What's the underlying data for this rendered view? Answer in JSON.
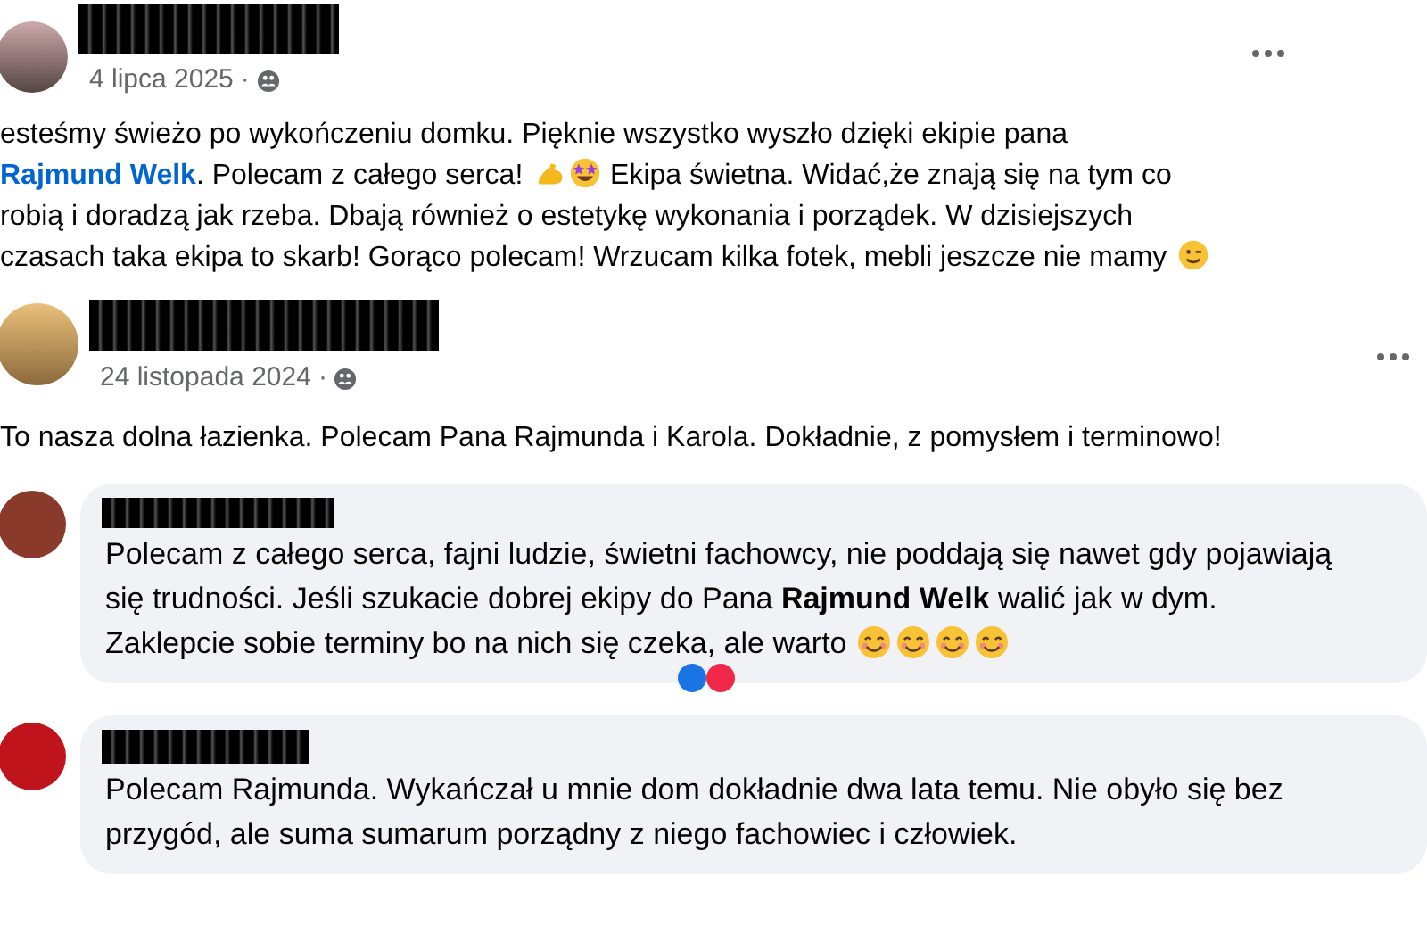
{
  "posts": [
    {
      "date": "4 lipca 2025",
      "separator": "·",
      "segments": [
        {
          "kind": "text",
          "text": "esteśmy świeżo po wykończeniu domku. Pięknie wszystko wyszło dzięki ekipie pana "
        },
        {
          "kind": "link",
          "text": "Rajmund Welk"
        },
        {
          "kind": "text",
          "text": ". Polecam z całego serca! "
        },
        {
          "kind": "arm"
        },
        {
          "kind": "starstruck"
        },
        {
          "kind": "text",
          "text": " Ekipa świetna. Widać,że znają się na tym co robią i doradzą jak rzeba. Dbają również o estetykę wykonania i porządek. W dzisiejszych czasach taka ekipa to skarb! Gorąco polecam! Wrzucam kilka fotek, mebli jeszcze nie mamy "
        },
        {
          "kind": "wink"
        }
      ]
    },
    {
      "date": "24 listopada 2024",
      "separator": "·",
      "segments": [
        {
          "kind": "text",
          "text": "To nasza dolna łazienka. Polecam Pana Rajmunda i Karola. Dokładnie, z pomysłem i terminowo!"
        }
      ]
    }
  ],
  "comments": [
    {
      "reactions_shown": true,
      "segments": [
        {
          "kind": "text",
          "text": "Polecam z całego serca, fajni ludzie, świetni fachowcy, nie poddają się nawet gdy pojawiają się trudności. Jeśli szukacie dobrej ekipy do Pana **Rajmund Welk** walić jak w dym. Zaklepcie sobie terminy bo na nich się czeka, ale warto "
        },
        {
          "kind": "smile"
        },
        {
          "kind": "smile"
        },
        {
          "kind": "smile"
        },
        {
          "kind": "smile"
        }
      ]
    },
    {
      "reactions_shown": false,
      "segments": [
        {
          "kind": "text",
          "text": "Polecam Rajmunda. Wykańczał u mnie dom dokładnie dwa lata temu. Nie obyło się bez przygód, ale suma sumarum porządny z niego fachowiec i człowiek."
        }
      ]
    }
  ]
}
